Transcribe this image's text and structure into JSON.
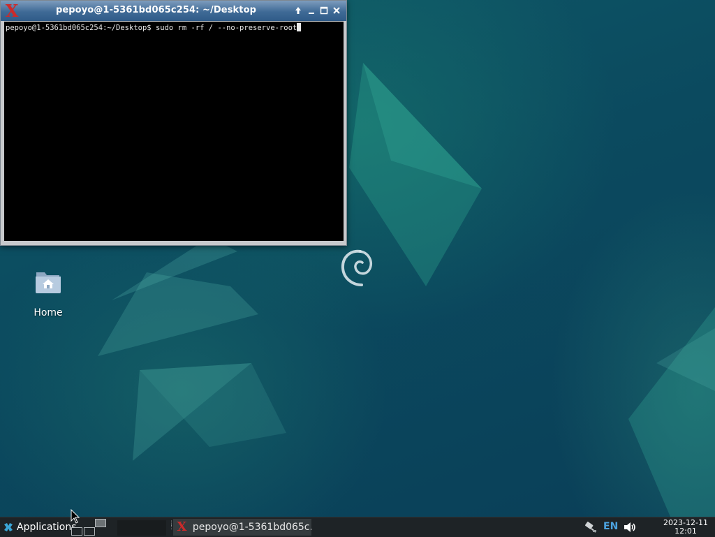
{
  "terminal": {
    "title": "pepoyo@1-5361bd065c254: ~/Desktop",
    "app_icon": "xterm-icon",
    "buttons": [
      "up-arrow-icon",
      "minimize-icon",
      "maximize-icon",
      "close-icon"
    ],
    "prompt": "pepoyo@1-5361bd065c254:~/Desktop$",
    "command": "sudo rm -rf / --no-preserve-root"
  },
  "desktop": {
    "icons": [
      {
        "label": "Home",
        "icon": "home-folder-icon"
      }
    ],
    "logo": "debian-swirl-icon"
  },
  "taskbar": {
    "applications_label": "Applications",
    "workspace_count": 4,
    "task_label": "pepoyo@1-5361bd065c...",
    "tray": {
      "network_icon": "network-icon",
      "language": "EN",
      "volume_icon": "volume-icon"
    },
    "clock": {
      "date": "2023-12-11",
      "time": "12:01"
    }
  },
  "colors": {
    "desktop_teal": "#0d4a5e",
    "titlebar_blue": "#3f6a96",
    "terminal_bg": "#000000",
    "taskbar_bg": "#1e2326",
    "language_blue": "#4ca3e0"
  }
}
